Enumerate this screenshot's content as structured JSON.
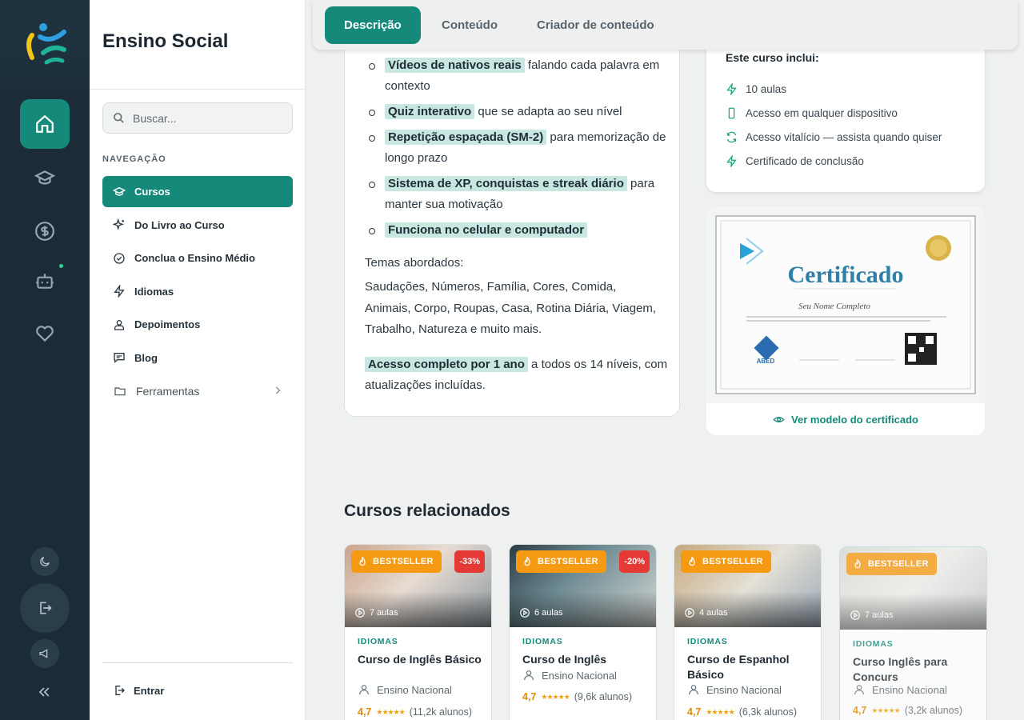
{
  "app": {
    "brand": "Ensino Social"
  },
  "rail": {
    "icons": [
      "logo-icon",
      "home-icon",
      "graduation-cap-icon",
      "dollar-icon",
      "bot-icon",
      "heart-icon",
      "moon-icon",
      "logout-icon",
      "megaphone-icon",
      "collapse-icon"
    ]
  },
  "sidebar": {
    "search_placeholder": "Buscar...",
    "nav_title": "NAVEGAÇÃO",
    "items": [
      {
        "label": "Cursos",
        "icon": "graduation-cap-icon",
        "active": true
      },
      {
        "label": "Do Livro ao Curso",
        "icon": "sparkles-icon"
      },
      {
        "label": "Conclua o Ensino Médio",
        "icon": "check-circle-icon"
      },
      {
        "label": "Idiomas",
        "icon": "lightning-icon"
      },
      {
        "label": "Depoimentos",
        "icon": "users-icon"
      },
      {
        "label": "Blog",
        "icon": "message-icon"
      }
    ],
    "tools_label": "Ferramentas",
    "login_label": "Entrar"
  },
  "tabs": [
    {
      "label": "Descrição",
      "active": true
    },
    {
      "label": "Conteúdo"
    },
    {
      "label": "Criador de conteúdo"
    }
  ],
  "description": {
    "bullets": [
      {
        "highlight": "Vídeos de nativos reais",
        "rest": " falando cada palavra em contexto"
      },
      {
        "highlight": "Quiz interativo",
        "rest": " que se adapta ao seu nível"
      },
      {
        "highlight": "Repetição espaçada (SM-2)",
        "rest": " para memorização de longo prazo"
      },
      {
        "highlight": "Sistema de XP, conquistas e streak diário",
        "rest": " para manter sua motivação"
      },
      {
        "highlight": "Funciona no celular e computador",
        "rest": ""
      }
    ],
    "topics_label": "Temas abordados:",
    "topics": "Saudações, Números, Família, Cores, Comida, Animais, Corpo, Roupas, Casa, Rotina Diária, Viagem, Trabalho, Natureza e muito mais.",
    "access_highlight": "Acesso completo por 1 ano",
    "access_rest": " a todos os 14 níveis, com atualizações incluídas."
  },
  "includes": {
    "title": "Este curso inclui:",
    "items": [
      {
        "label": "10 aulas",
        "icon": "lightning-icon"
      },
      {
        "label": "Acesso em qualquer dispositivo",
        "icon": "phone-icon"
      },
      {
        "label": "Acesso vitalício — assista quando quiser",
        "icon": "refresh-icon"
      },
      {
        "label": "Certificado de conclusão",
        "icon": "lightning-icon"
      }
    ]
  },
  "certificate": {
    "heading": "Certificado",
    "name": "Seu Nome Completo",
    "org": "ABED",
    "link_label": "Ver modelo do certificado"
  },
  "related": {
    "title": "Cursos relacionados",
    "courses": [
      {
        "badge": "BESTSELLER",
        "discount": "-33%",
        "lessons": "7 aulas",
        "category": "IDIOMAS",
        "title": "Curso de Inglês Básico",
        "author": "Ensino Nacional",
        "rating": "4,7",
        "students": "(11,2k alunos)",
        "rating_value": 4.7
      },
      {
        "badge": "BESTSELLER",
        "discount": "-20%",
        "lessons": "6 aulas",
        "category": "IDIOMAS",
        "title": "Curso de Inglês",
        "author": "Ensino Nacional",
        "rating": "4,7",
        "students": "(9,6k alunos)",
        "rating_value": 4.7
      },
      {
        "badge": "BESTSELLER",
        "discount": "",
        "lessons": "4 aulas",
        "category": "IDIOMAS",
        "title": "Curso de Espanhol Básico",
        "author": "Ensino Nacional",
        "rating": "4,7",
        "students": "(6,3k alunos)",
        "rating_value": 4.7
      },
      {
        "badge": "BESTSELLER",
        "discount": "",
        "lessons": "7 aulas",
        "category": "IDIOMAS",
        "title": "Curso Inglês para Concurs",
        "author": "Ensino Nacional",
        "rating": "4,7",
        "students": "(3,2k alunos)",
        "rating_value": 4.7
      }
    ]
  },
  "colors": {
    "accent": "#15897a",
    "rail": "#1b2b38",
    "badge": "#f59a12",
    "discount": "#e53935"
  }
}
